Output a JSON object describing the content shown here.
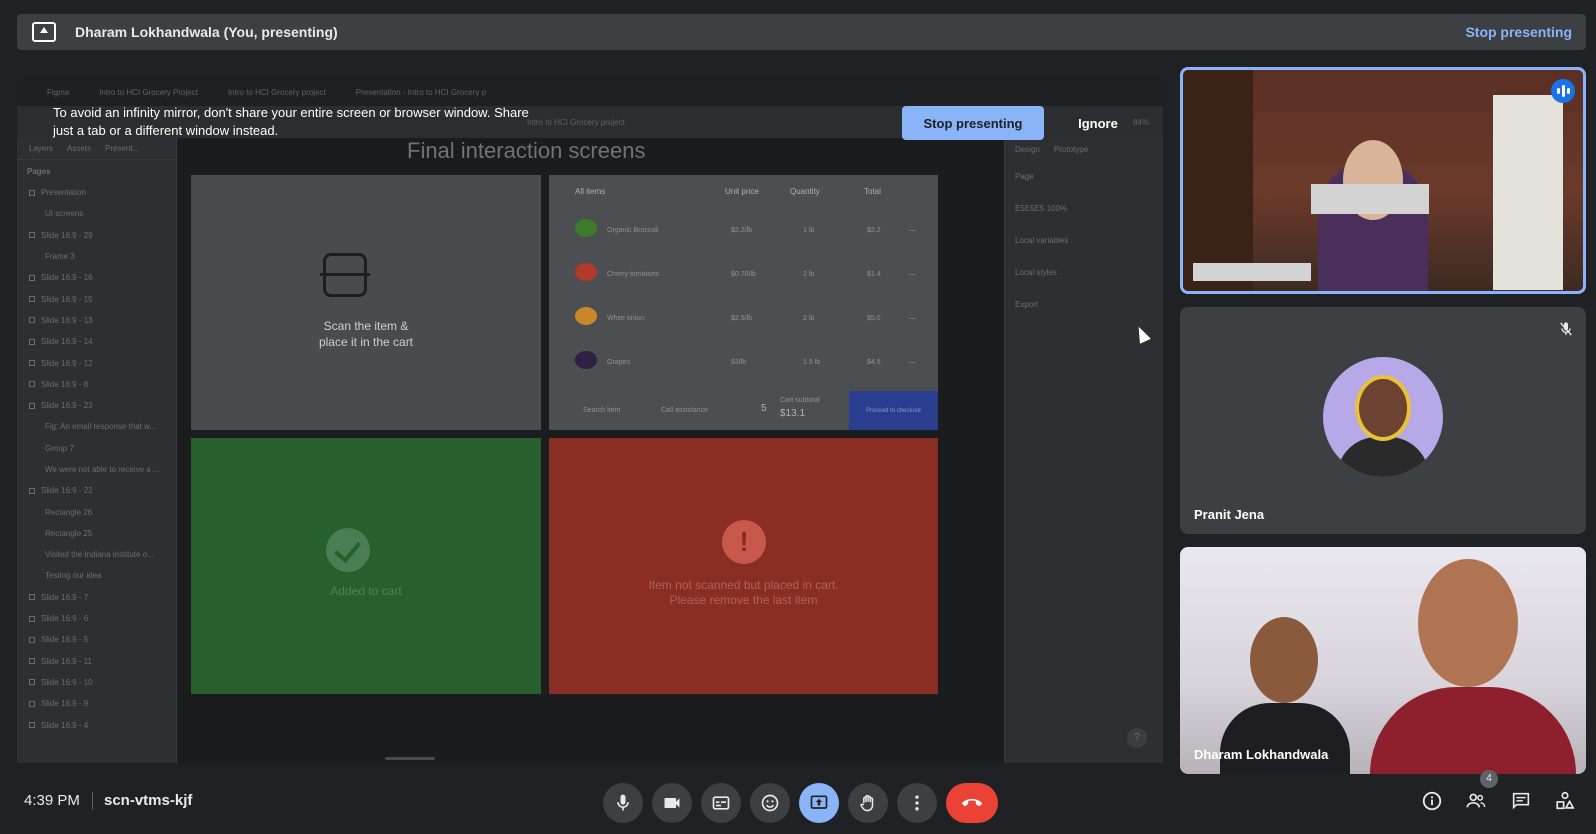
{
  "present_bar": {
    "title": "Dharam Lokhandwala (You, presenting)",
    "stop_label": "Stop presenting"
  },
  "shared_screen": {
    "browser_tabs": [
      "Figma",
      "Intro to HCI Grocery Project",
      "Intro to HCI Grocery project",
      "Presentation - Intro to HCI Grocery p"
    ],
    "file_title": "Intro to HCI Grocery project",
    "zoom": "84%",
    "left_panel": {
      "tabs": [
        "Layers",
        "Assets",
        "Present..."
      ],
      "pages_label": "Pages",
      "items": [
        {
          "label": "Presentation",
          "sub": false
        },
        {
          "label": "UI screens",
          "sub": true
        },
        {
          "label": "Slide 16:9 - 29",
          "sub": false
        },
        {
          "label": "Frame 3",
          "sub": true
        },
        {
          "label": "Slide 16:9 - 16",
          "sub": false
        },
        {
          "label": "Slide 16:9 - 15",
          "sub": false
        },
        {
          "label": "Slide 16:9 - 13",
          "sub": false
        },
        {
          "label": "Slide 16:9 - 14",
          "sub": false
        },
        {
          "label": "Slide 16:9 - 12",
          "sub": false
        },
        {
          "label": "Slide 16:9 - 8",
          "sub": false
        },
        {
          "label": "Slide 16:9 - 23",
          "sub": false
        },
        {
          "label": "Fig: An email response that w...",
          "sub": true
        },
        {
          "label": "Group 7",
          "sub": true
        },
        {
          "label": "We were not able to receive a ...",
          "sub": true
        },
        {
          "label": "Slide 16:9 - 22",
          "sub": false
        },
        {
          "label": "Rectangle 26",
          "sub": true
        },
        {
          "label": "Rectangle 25",
          "sub": true
        },
        {
          "label": "Visited the Indiana institute o...",
          "sub": true
        },
        {
          "label": "Testing our idea",
          "sub": true
        },
        {
          "label": "Slide 16:9 - 7",
          "sub": false
        },
        {
          "label": "Slide 16:9 - 6",
          "sub": false
        },
        {
          "label": "Slide 16:9 - 5",
          "sub": false
        },
        {
          "label": "Slide 16:9 - 11",
          "sub": false
        },
        {
          "label": "Slide 16:9 - 10",
          "sub": false
        },
        {
          "label": "Slide 16:9 - 9",
          "sub": false
        },
        {
          "label": "Slide 16:9 - 4",
          "sub": false
        }
      ]
    },
    "right_panel": {
      "tabs": [
        "Design",
        "Prototype"
      ],
      "rows": [
        "Page",
        "E5E5E5   100%",
        "Local variables",
        "Local styles",
        "Export"
      ]
    },
    "canvas": {
      "frame_title": "Final interaction screens",
      "scan_text_1": "Scan the item &",
      "scan_text_2": "place it in the cart",
      "list_headers": [
        "All items",
        "Unit price",
        "Quantity",
        "Total"
      ],
      "list_rows": [
        {
          "name": "Organic Broccoli",
          "unit": "$2.2/lb",
          "qty": "1 lb",
          "total": "$2.2",
          "color": "#3e7a2c"
        },
        {
          "name": "Cherry tomatoes",
          "unit": "$0.70/lb",
          "qty": "2 lb",
          "total": "$1.4",
          "color": "#b3392a"
        },
        {
          "name": "White onion",
          "unit": "$2.5/lb",
          "qty": "2 lb",
          "total": "$5.0",
          "color": "#c9862a"
        },
        {
          "name": "Grapes",
          "unit": "$3/lb",
          "qty": "1.5 lb",
          "total": "$4.5",
          "color": "#2c2140"
        }
      ],
      "search_item": "Search item",
      "call_assistance": "Call assistance",
      "cart_count": "5",
      "cart_subtotal_label": "Cart subtotal",
      "cart_subtotal": "$13.1",
      "proceed_label": "Proceed to checkout",
      "green_text": "Added to cart",
      "red_text_1": "Item not scanned but placed in cart.",
      "red_text_2": "Please remove the last item"
    },
    "warning": {
      "text_1": "To avoid an infinity mirror, don't share your entire screen or browser window. Share",
      "text_2": "just a tab or a different window instead.",
      "stop_label": "Stop presenting",
      "ignore_label": "Ignore"
    }
  },
  "participants": [
    {
      "name": "",
      "speaking": true
    },
    {
      "name": "Pranit Jena",
      "muted": true
    },
    {
      "name": "Dharam Lokhandwala"
    }
  ],
  "bottom_bar": {
    "time": "4:39 PM",
    "meeting_code": "scn-vtms-kjf",
    "people_count": "4",
    "colors": {
      "end_call": "#ea4335",
      "active_present": "#8ab4f8"
    }
  }
}
